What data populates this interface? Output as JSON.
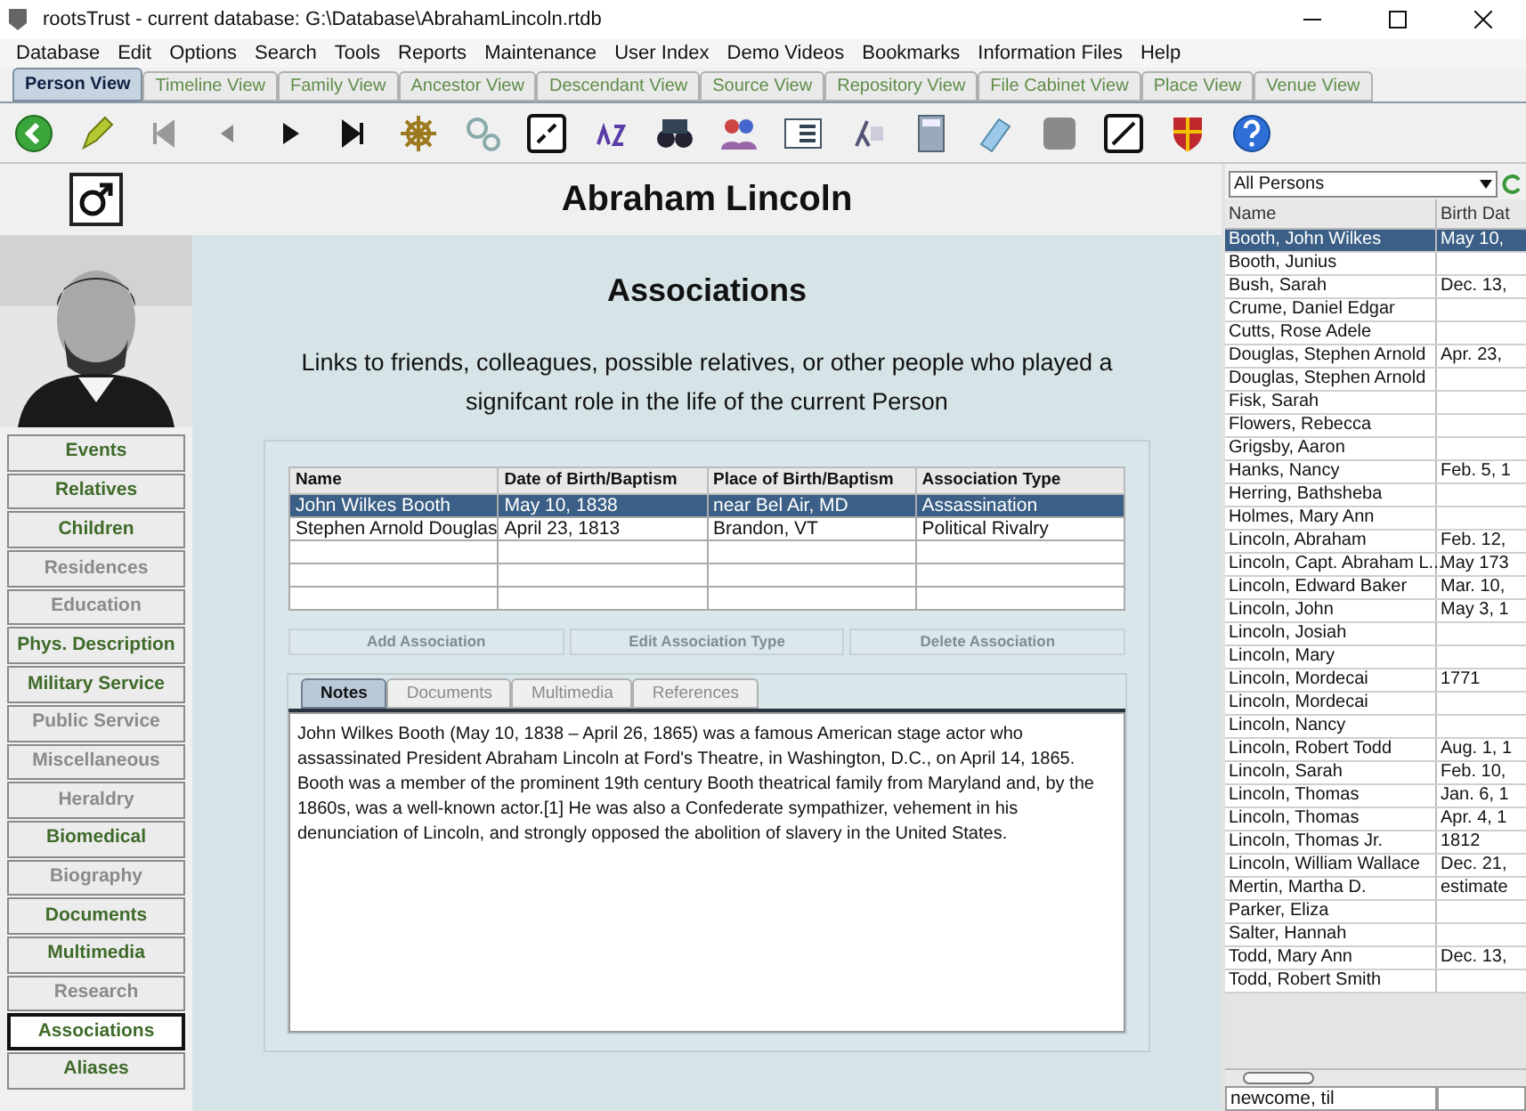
{
  "window": {
    "title": "rootsTrust - current database: G:\\Database\\AbrahamLincoln.rtdb"
  },
  "menu": [
    "Database",
    "Edit",
    "Options",
    "Search",
    "Tools",
    "Reports",
    "Maintenance",
    "User Index",
    "Demo Videos",
    "Bookmarks",
    "Information Files",
    "Help"
  ],
  "view_tabs": [
    {
      "label": "Person View",
      "selected": true
    },
    {
      "label": "Timeline View",
      "selected": false
    },
    {
      "label": "Family View",
      "selected": false
    },
    {
      "label": "Ancestor View",
      "selected": false
    },
    {
      "label": "Descendant View",
      "selected": false
    },
    {
      "label": "Source View",
      "selected": false
    },
    {
      "label": "Repository View",
      "selected": false
    },
    {
      "label": "File Cabinet View",
      "selected": false
    },
    {
      "label": "Place View",
      "selected": false
    },
    {
      "label": "Venue View",
      "selected": false
    }
  ],
  "person": {
    "name": "Abraham Lincoln"
  },
  "sections": [
    {
      "label": "Events",
      "has_data": true,
      "selected": false
    },
    {
      "label": "Relatives",
      "has_data": true,
      "selected": false
    },
    {
      "label": "Children",
      "has_data": true,
      "selected": false
    },
    {
      "label": "Residences",
      "has_data": false,
      "selected": false
    },
    {
      "label": "Education",
      "has_data": false,
      "selected": false
    },
    {
      "label": "Phys. Description",
      "has_data": true,
      "selected": false
    },
    {
      "label": "Military Service",
      "has_data": true,
      "selected": false
    },
    {
      "label": "Public Service",
      "has_data": false,
      "selected": false
    },
    {
      "label": "Miscellaneous",
      "has_data": false,
      "selected": false
    },
    {
      "label": "Heraldry",
      "has_data": false,
      "selected": false
    },
    {
      "label": "Biomedical",
      "has_data": true,
      "selected": false
    },
    {
      "label": "Biography",
      "has_data": false,
      "selected": false
    },
    {
      "label": "Documents",
      "has_data": true,
      "selected": false
    },
    {
      "label": "Multimedia",
      "has_data": true,
      "selected": false
    },
    {
      "label": "Research",
      "has_data": false,
      "selected": false
    },
    {
      "label": "Associations",
      "has_data": true,
      "selected": true
    },
    {
      "label": "Aliases",
      "has_data": true,
      "selected": false
    }
  ],
  "associations": {
    "title": "Associations",
    "description": "Links to friends, colleagues, possible relatives, or other people who played a signifcant role in the life of the current Person",
    "columns": [
      "Name",
      "Date of Birth/Baptism",
      "Place of Birth/Baptism",
      "Association Type"
    ],
    "rows": [
      {
        "cells": [
          "John Wilkes Booth",
          "May 10, 1838",
          "near Bel Air, MD",
          "Assassination"
        ],
        "selected": true
      },
      {
        "cells": [
          "Stephen Arnold Douglas",
          "April 23, 1813",
          "Brandon, VT",
          "Political Rivalry"
        ],
        "selected": false
      }
    ],
    "buttons": [
      {
        "label": "Add Association",
        "disabled": true
      },
      {
        "label": "Edit Association Type",
        "disabled": true
      },
      {
        "label": "Delete Association",
        "disabled": true
      }
    ],
    "tabs": [
      {
        "label": "Notes",
        "selected": true
      },
      {
        "label": "Documents",
        "selected": false
      },
      {
        "label": "Multimedia",
        "selected": false
      },
      {
        "label": "References",
        "selected": false
      }
    ],
    "notes": "John Wilkes Booth (May 10, 1838 – April 26, 1865) was a famous American stage actor who assassinated President Abraham Lincoln at Ford's Theatre, in Washington, D.C., on April 14, 1865. Booth was a member of the prominent 19th century Booth theatrical family from Maryland and, by the 1860s, was a well-known actor.[1] He was also a Confederate sympathizer, vehement in his denunciation of Lincoln, and strongly opposed the abolition of slavery in the United States."
  },
  "person_list": {
    "filter": "All Persons",
    "columns": [
      "Name",
      "Birth Dat"
    ],
    "rows": [
      {
        "name": "Booth, John Wilkes",
        "birth": "May 10,",
        "selected": true
      },
      {
        "name": "Booth, Junius",
        "selected": false
      },
      {
        "name": "Bush, Sarah",
        "birth": "Dec. 13,",
        "selected": false
      },
      {
        "name": "Crume, Daniel Edgar",
        "selected": false
      },
      {
        "name": "Cutts, Rose Adele",
        "selected": false
      },
      {
        "name": "Douglas, Stephen Arnold",
        "birth": "Apr. 23,",
        "selected": false
      },
      {
        "name": "Douglas, Stephen Arnold",
        "selected": false
      },
      {
        "name": "Fisk, Sarah",
        "selected": false
      },
      {
        "name": "Flowers, Rebecca",
        "selected": false
      },
      {
        "name": "Grigsby, Aaron",
        "selected": false
      },
      {
        "name": "Hanks, Nancy",
        "birth": "Feb. 5, 1",
        "selected": false
      },
      {
        "name": "Herring, Bathsheba",
        "selected": false
      },
      {
        "name": "Holmes, Mary Ann",
        "selected": false
      },
      {
        "name": "Lincoln, Abraham",
        "birth": "Feb. 12,",
        "selected": false
      },
      {
        "name": "Lincoln, Capt. Abraham L...",
        "birth": "May 173",
        "selected": false
      },
      {
        "name": "Lincoln, Edward Baker",
        "birth": "Mar. 10,",
        "selected": false
      },
      {
        "name": "Lincoln, John",
        "birth": "May 3, 1",
        "selected": false
      },
      {
        "name": "Lincoln, Josiah",
        "selected": false
      },
      {
        "name": "Lincoln, Mary",
        "selected": false
      },
      {
        "name": "Lincoln, Mordecai",
        "birth": "1771",
        "selected": false
      },
      {
        "name": "Lincoln, Mordecai",
        "selected": false
      },
      {
        "name": "Lincoln, Nancy",
        "selected": false
      },
      {
        "name": "Lincoln, Robert Todd",
        "birth": "Aug. 1, 1",
        "selected": false
      },
      {
        "name": "Lincoln, Sarah",
        "birth": "Feb. 10,",
        "selected": false
      },
      {
        "name": "Lincoln, Thomas",
        "birth": "Jan. 6, 1",
        "selected": false
      },
      {
        "name": "Lincoln, Thomas",
        "birth": "Apr. 4, 1",
        "selected": false
      },
      {
        "name": "Lincoln, Thomas Jr.",
        "birth": "1812",
        "selected": false
      },
      {
        "name": "Lincoln, William Wallace",
        "birth": "Dec. 21,",
        "selected": false
      },
      {
        "name": "Mertin, Martha D.",
        "birth": "estimate",
        "selected": false
      },
      {
        "name": "Parker, Eliza",
        "selected": false
      },
      {
        "name": "Salter, Hannah",
        "selected": false
      },
      {
        "name": "Todd, Mary Ann",
        "birth": "Dec. 13,",
        "selected": false
      },
      {
        "name": "Todd, Robert Smith",
        "selected": false
      }
    ],
    "search": "newcome, til"
  }
}
